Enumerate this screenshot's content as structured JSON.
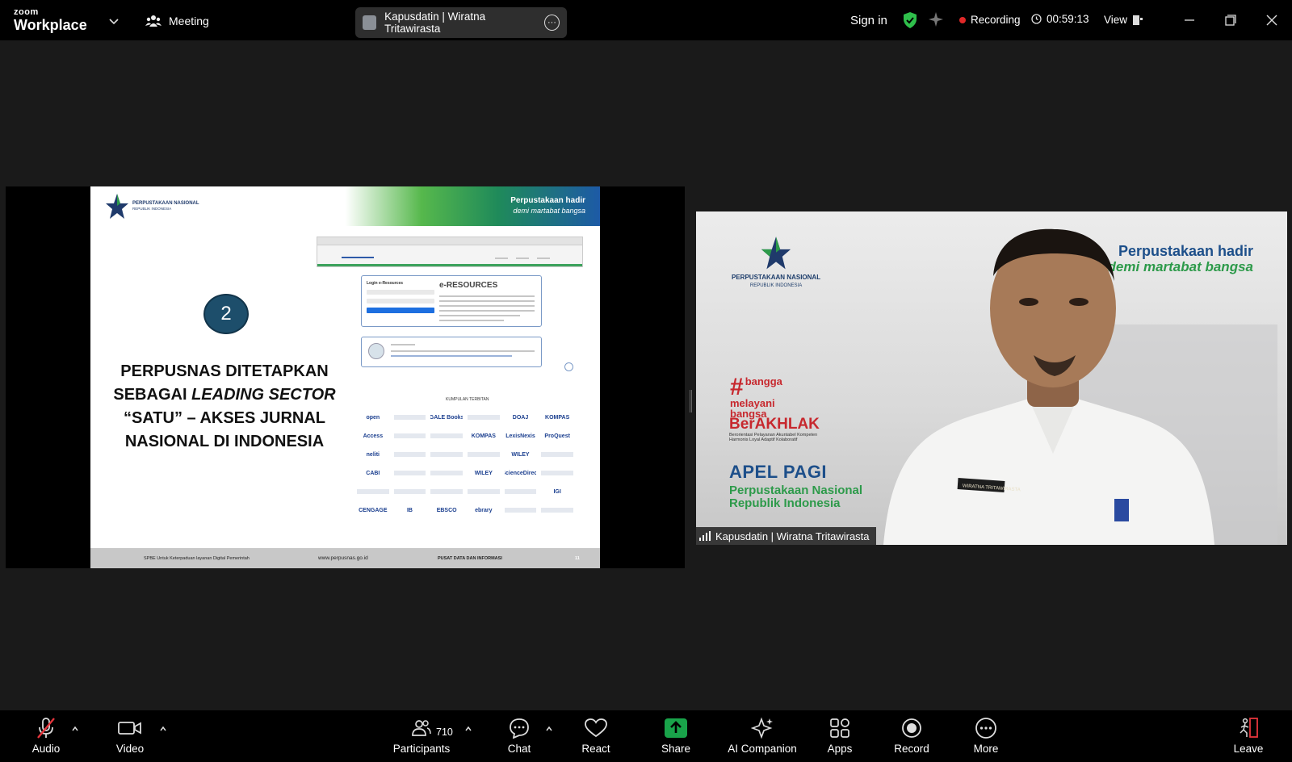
{
  "app": {
    "brand_small": "zoom",
    "brand_large": "Workplace"
  },
  "topbar": {
    "meeting_label": "Meeting",
    "speaker_pill": "Kapusdatin | Wiratna Tritawirasta",
    "sign_in": "Sign in",
    "recording_label": "Recording",
    "timer": "00:59:13",
    "view_label": "View"
  },
  "slide": {
    "org_name": "PERPUSTAKAAN NASIONAL",
    "org_sub": "REPUBLIK INDONESIA",
    "tagline_1": "Perpustakaan hadir",
    "tagline_2": "demi martabat bangsa",
    "number": "2",
    "title_line1": "PERPUSNAS DITETAPKAN",
    "title_line2a": "SEBAGAI ",
    "title_line2b": "LEADING SECTOR",
    "title_line3": "“SATU” – AKSES JURNAL",
    "title_line4": "NASIONAL DI INDONESIA",
    "eresources": "e-RESOURCES",
    "login_title": "Login e-Resources",
    "kumpulan": "KUMPULAN TERBITAN",
    "logos": [
      "open",
      "",
      "GALE Books",
      "",
      "DOAJ",
      "KOMPAS",
      "Access",
      "",
      "",
      "KOMPAS",
      "LexisNexis",
      "ProQuest",
      "neliti",
      "",
      "",
      "",
      "WILEY",
      "",
      "CABI",
      "",
      "",
      "WILEY",
      "ScienceDirect",
      "",
      "",
      "",
      "",
      "",
      "",
      "IGI",
      "CENGAGE",
      "IB",
      "EBSCO",
      "ebrary",
      "",
      ""
    ],
    "footer_left": "SPBE Untuk Keterpaduan layanan Digital Pemerintah",
    "footer_url": "www.perpusnas.go.id",
    "footer_center": "PUSAT DATA DAN INFORMASI",
    "footer_page": "11"
  },
  "video": {
    "org_name": "PERPUSTAKAAN NASIONAL",
    "org_sub": "REPUBLIK INDONESIA",
    "tagline_1": "Perpustakaan hadir",
    "tagline_2": "demi martabat bangsa",
    "bangga_1": "bangga",
    "bangga_2": "melayani",
    "bangga_3": "bangsa",
    "berakhlak": "BerAKHLAK",
    "berakhlak_sub": "Berorientasi Pelayanan Akuntabel Kompeten Harmonis Loyal Adaptif Kolaboratif",
    "apel": "APEL PAGI",
    "pn_1": "Perpustakaan Nasional",
    "pn_2": "Republik Indonesia",
    "name_badge": "WIRATNA TRITAWIRASTA",
    "name_tag": "Kapusdatin | Wiratna Tritawirasta"
  },
  "toolbar": {
    "audio": "Audio",
    "video": "Video",
    "participants": "Participants",
    "participant_count": "710",
    "chat": "Chat",
    "react": "React",
    "share": "Share",
    "ai_companion": "AI Companion",
    "apps": "Apps",
    "record": "Record",
    "more": "More",
    "leave": "Leave"
  },
  "colors": {
    "share_green": "#19a34a",
    "record_red": "#e02828",
    "leave_red": "#e5353c",
    "shield_green": "#2fbf4b"
  }
}
